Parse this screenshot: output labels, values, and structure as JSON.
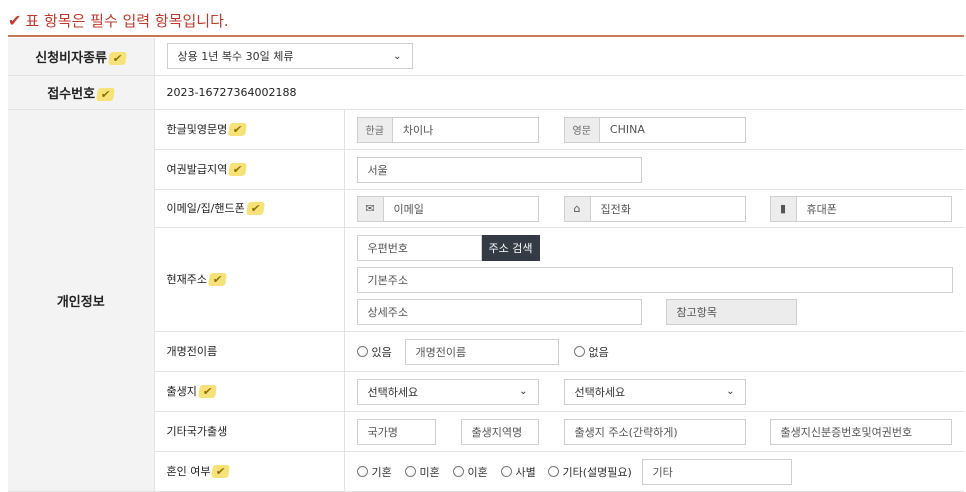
{
  "notice": {
    "check": "✔",
    "text": "표 항목은 필수 입력 항목입니다."
  },
  "mark": "✔",
  "rows": {
    "visa_type": {
      "label": "신청비자종류",
      "selected": "상용 1년 복수 30일 체류"
    },
    "receipt": {
      "label": "접수번호",
      "value": "2023-16727364002188"
    },
    "personal": {
      "label": "개인정보"
    },
    "name": {
      "label": "한글및영문명",
      "kor_tag": "한글",
      "kor_value": "차이나",
      "eng_tag": "영문",
      "eng_value": "CHINA"
    },
    "passport_region": {
      "label": "여권발급지역",
      "value": "서울"
    },
    "contact": {
      "label": "이메일/집/핸드폰",
      "email_ph": "이메일",
      "home_ph": "집전화",
      "mobile_ph": "휴대폰",
      "email_icon": "envelope-icon",
      "home_icon": "home-icon",
      "mobile_icon": "mobile-phone-icon"
    },
    "address": {
      "label": "현재주소",
      "zip_ph": "우편번호",
      "search_btn": "주소 검색",
      "base_ph": "기본주소",
      "detail_ph": "상세주소",
      "ref_ph": "참고항목"
    },
    "former_name": {
      "label": "개명전이름",
      "yes": "있음",
      "field_ph": "개명전이름",
      "no": "없음"
    },
    "birthplace": {
      "label": "출생지",
      "select1": "선택하세요",
      "select2": "선택하세요"
    },
    "other_birth": {
      "label": "기타국가출생",
      "country_ph": "국가명",
      "region_ph": "출생지역명",
      "addr_ph": "출생지 주소(간략하게)",
      "id_ph": "출생지신분증번호및여권번호"
    },
    "marital": {
      "label": "혼인 여부",
      "options": [
        "기혼",
        "미혼",
        "이혼",
        "사별",
        "기타(설명필요)"
      ],
      "etc_ph": "기타"
    }
  },
  "colors": {
    "accent": "#c0392b",
    "rule": "#c87a55",
    "highlight": "#f7e27a",
    "dark_button": "#353b44"
  }
}
